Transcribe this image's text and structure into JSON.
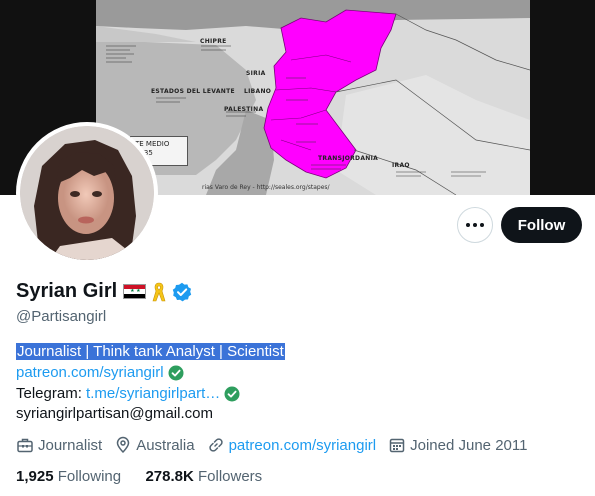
{
  "banner": {
    "map_labels": [
      "CHIPRE",
      "SIRIA",
      "ESTADOS DEL LEVANTE",
      "LIBANO",
      "PALESTINA",
      "TRANSJORDANIA",
      "IRAQ"
    ],
    "legend_text": "TE MEDIO\n1935",
    "credit": "rias Varo de Rey - http://seales.org/stapes/"
  },
  "profile": {
    "display_name": "Syrian Girl",
    "handle": "@Partisangirl",
    "bio_highlighted": "Journalist | Think tank Analyst | Scientist",
    "patreon_link": "patreon.com/syriangirl",
    "telegram_label": "Telegram: ",
    "telegram_link": "t.me/syriangirlpart…",
    "email": "syriangirlpartisan@gmail.com"
  },
  "actions": {
    "follow_label": "Follow"
  },
  "meta": {
    "occupation": "Journalist",
    "location": "Australia",
    "website": "patreon.com/syriangirl",
    "joined": "Joined June 2011"
  },
  "stats": {
    "following_count": "1,925",
    "following_label": "Following",
    "followers_count": "278.8K",
    "followers_label": "Followers"
  },
  "colors": {
    "accent": "#1d9bf0",
    "highlight": "#3b73d8",
    "map_region": "#ff00ff"
  }
}
